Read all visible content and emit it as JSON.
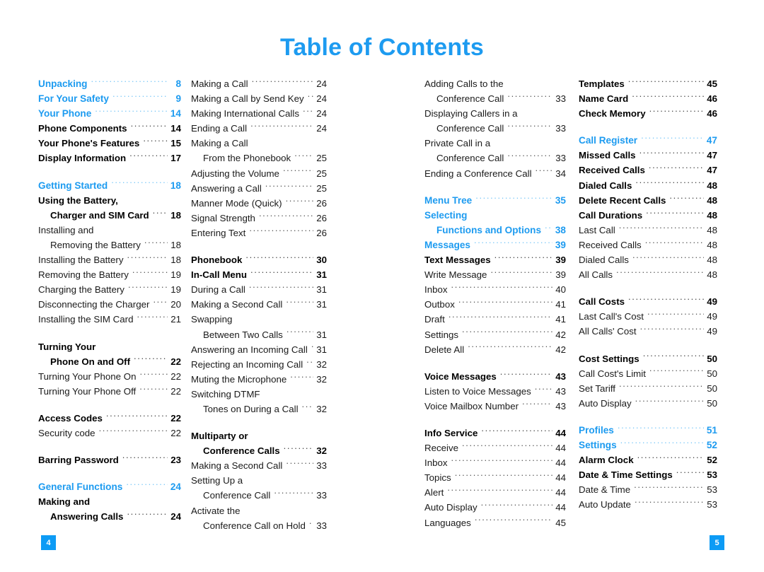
{
  "page": {
    "title": "Table of Contents",
    "accent_color": "#1d9bf0",
    "badge_color": "#0d9bf5",
    "left_page_number": "4",
    "right_page_number": "5"
  },
  "columns": [
    {
      "id": "column-1",
      "entries": [
        {
          "label": "Unpacking",
          "page": "8",
          "level": "section"
        },
        {
          "label": "For Your Safety",
          "page": "9",
          "level": "section"
        },
        {
          "label": "Your Phone",
          "page": "14",
          "level": "section"
        },
        {
          "label": "Phone Components",
          "page": "14",
          "level": "sub"
        },
        {
          "label": "Your Phone's Features",
          "page": "15",
          "level": "sub"
        },
        {
          "label": "Display Information",
          "page": "17",
          "level": "sub"
        },
        {
          "type": "gap"
        },
        {
          "label": "Getting Started",
          "page": "18",
          "level": "section"
        },
        {
          "label": "Using the Battery,",
          "page": "",
          "level": "sub",
          "leader": false
        },
        {
          "label": "Charger and SIM Card",
          "page": "18",
          "level": "sub",
          "indent": true
        },
        {
          "label": "Installing and",
          "page": "",
          "level": "item",
          "leader": false
        },
        {
          "label": "Removing the Battery",
          "page": "18",
          "level": "item",
          "indent": true
        },
        {
          "label": "Installing the Battery",
          "page": "18",
          "level": "item"
        },
        {
          "label": "Removing the Battery",
          "page": "19",
          "level": "item"
        },
        {
          "label": "Charging the Battery",
          "page": "19",
          "level": "item"
        },
        {
          "label": "Disconnecting the Charger",
          "page": "20",
          "level": "item"
        },
        {
          "label": "Installing the SIM Card",
          "page": "21",
          "level": "item"
        },
        {
          "type": "gap"
        },
        {
          "label": "Turning Your",
          "page": "",
          "level": "sub",
          "leader": false
        },
        {
          "label": "Phone On and Off",
          "page": "22",
          "level": "sub",
          "indent": true
        },
        {
          "label": "Turning Your Phone On",
          "page": "22",
          "level": "item"
        },
        {
          "label": "Turning Your Phone Off",
          "page": "22",
          "level": "item"
        },
        {
          "type": "gap"
        },
        {
          "label": "Access Codes",
          "page": "22",
          "level": "sub"
        },
        {
          "label": "Security code",
          "page": "22",
          "level": "item"
        },
        {
          "type": "gap"
        },
        {
          "label": "Barring Password",
          "page": "23",
          "level": "sub"
        },
        {
          "type": "gap"
        },
        {
          "label": "General Functions",
          "page": "24",
          "level": "section"
        },
        {
          "label": "Making and",
          "page": "",
          "level": "sub",
          "leader": false
        },
        {
          "label": "Answering Calls",
          "page": "24",
          "level": "sub",
          "indent": true
        }
      ]
    },
    {
      "id": "column-2",
      "entries": [
        {
          "label": "Making a Call",
          "page": "24",
          "level": "item"
        },
        {
          "label": "Making a Call by Send Key",
          "page": "24",
          "level": "item"
        },
        {
          "label": "Making International Calls",
          "page": "24",
          "level": "item"
        },
        {
          "label": "Ending a Call",
          "page": "24",
          "level": "item"
        },
        {
          "label": "Making a Call",
          "page": "",
          "level": "item",
          "leader": false
        },
        {
          "label": "From the Phonebook",
          "page": "25",
          "level": "item",
          "indent": true
        },
        {
          "label": "Adjusting the Volume",
          "page": "25",
          "level": "item"
        },
        {
          "label": "Answering a Call",
          "page": "25",
          "level": "item"
        },
        {
          "label": "Manner Mode (Quick)",
          "page": "26",
          "level": "item"
        },
        {
          "label": "Signal Strength",
          "page": "26",
          "level": "item"
        },
        {
          "label": "Entering Text",
          "page": "26",
          "level": "item"
        },
        {
          "type": "gap"
        },
        {
          "label": "Phonebook",
          "page": "30",
          "level": "sub"
        },
        {
          "label": "In-Call Menu",
          "page": "31",
          "level": "sub"
        },
        {
          "label": "During a Call",
          "page": "31",
          "level": "item"
        },
        {
          "label": "Making a Second Call",
          "page": "31",
          "level": "item"
        },
        {
          "label": "Swapping",
          "page": "",
          "level": "item",
          "leader": false
        },
        {
          "label": "Between Two Calls",
          "page": "31",
          "level": "item",
          "indent": true
        },
        {
          "label": "Answering an Incoming Call",
          "page": "31",
          "level": "item"
        },
        {
          "label": "Rejecting an Incoming Call",
          "page": "32",
          "level": "item"
        },
        {
          "label": "Muting the Microphone",
          "page": "32",
          "level": "item"
        },
        {
          "label": "Switching DTMF",
          "page": "",
          "level": "item",
          "leader": false
        },
        {
          "label": "Tones on During a Call",
          "page": "32",
          "level": "item",
          "indent": true
        },
        {
          "type": "gap"
        },
        {
          "label": "Multiparty or",
          "page": "",
          "level": "sub",
          "leader": false
        },
        {
          "label": "Conference Calls",
          "page": "32",
          "level": "sub",
          "indent": true
        },
        {
          "label": "Making a Second Call",
          "page": "33",
          "level": "item"
        },
        {
          "label": "Setting Up a",
          "page": "",
          "level": "item",
          "leader": false
        },
        {
          "label": "Conference Call",
          "page": "33",
          "level": "item",
          "indent": true
        },
        {
          "label": "Activate the",
          "page": "",
          "level": "item",
          "leader": false
        },
        {
          "label": "Conference Call on Hold",
          "page": "33",
          "level": "item",
          "indent": true
        }
      ]
    },
    {
      "id": "column-3",
      "entries": [
        {
          "label": "Adding Calls to the",
          "page": "",
          "level": "item",
          "leader": false
        },
        {
          "label": "Conference Call",
          "page": "33",
          "level": "item",
          "indent": true
        },
        {
          "label": "Displaying Callers in a",
          "page": "",
          "level": "item",
          "leader": false
        },
        {
          "label": "Conference Call",
          "page": "33",
          "level": "item",
          "indent": true
        },
        {
          "label": "Private Call in a",
          "page": "",
          "level": "item",
          "leader": false
        },
        {
          "label": "Conference Call",
          "page": "33",
          "level": "item",
          "indent": true
        },
        {
          "label": "Ending a Conference Call",
          "page": "34",
          "level": "item"
        },
        {
          "type": "gap"
        },
        {
          "label": "Menu Tree",
          "page": "35",
          "level": "section"
        },
        {
          "label": "Selecting",
          "page": "",
          "level": "section",
          "leader": false
        },
        {
          "label": "Functions and Options",
          "page": "38",
          "level": "section",
          "indent": true
        },
        {
          "label": "Messages",
          "page": "39",
          "level": "section"
        },
        {
          "label": "Text Messages",
          "page": "39",
          "level": "sub"
        },
        {
          "label": "Write Message",
          "page": "39",
          "level": "item"
        },
        {
          "label": "Inbox",
          "page": "40",
          "level": "item"
        },
        {
          "label": "Outbox",
          "page": "41",
          "level": "item"
        },
        {
          "label": "Draft",
          "page": "41",
          "level": "item"
        },
        {
          "label": "Settings",
          "page": "42",
          "level": "item"
        },
        {
          "label": "Delete All",
          "page": "42",
          "level": "item"
        },
        {
          "type": "gap"
        },
        {
          "label": "Voice Messages",
          "page": "43",
          "level": "sub"
        },
        {
          "label": "Listen to Voice Messages",
          "page": "43",
          "level": "item"
        },
        {
          "label": "Voice Mailbox Number",
          "page": "43",
          "level": "item"
        },
        {
          "type": "gap"
        },
        {
          "label": "Info Service",
          "page": "44",
          "level": "sub"
        },
        {
          "label": "Receive",
          "page": "44",
          "level": "item"
        },
        {
          "label": "Inbox",
          "page": "44",
          "level": "item"
        },
        {
          "label": "Topics",
          "page": "44",
          "level": "item"
        },
        {
          "label": "Alert",
          "page": "44",
          "level": "item"
        },
        {
          "label": "Auto Display",
          "page": "44",
          "level": "item"
        },
        {
          "label": "Languages",
          "page": "45",
          "level": "item"
        }
      ]
    },
    {
      "id": "column-4",
      "entries": [
        {
          "label": "Templates",
          "page": "45",
          "level": "sub"
        },
        {
          "label": "Name Card",
          "page": "46",
          "level": "sub"
        },
        {
          "label": "Check Memory",
          "page": "46",
          "level": "sub"
        },
        {
          "type": "gap"
        },
        {
          "label": "Call Register",
          "page": "47",
          "level": "section"
        },
        {
          "label": "Missed Calls",
          "page": "47",
          "level": "sub"
        },
        {
          "label": "Received Calls",
          "page": "47",
          "level": "sub"
        },
        {
          "label": "Dialed Calls",
          "page": "48",
          "level": "sub"
        },
        {
          "label": "Delete Recent Calls",
          "page": "48",
          "level": "sub"
        },
        {
          "label": "Call Durations",
          "page": "48",
          "level": "sub"
        },
        {
          "label": "Last Call",
          "page": "48",
          "level": "item"
        },
        {
          "label": "Received Calls",
          "page": "48",
          "level": "item"
        },
        {
          "label": "Dialed Calls",
          "page": "48",
          "level": "item"
        },
        {
          "label": "All Calls",
          "page": "48",
          "level": "item"
        },
        {
          "type": "gap"
        },
        {
          "label": "Call Costs",
          "page": "49",
          "level": "sub"
        },
        {
          "label": "Last Call's Cost",
          "page": "49",
          "level": "item"
        },
        {
          "label": "All Calls' Cost",
          "page": "49",
          "level": "item"
        },
        {
          "type": "gap"
        },
        {
          "label": "Cost Settings",
          "page": "50",
          "level": "sub"
        },
        {
          "label": "Call Cost's Limit",
          "page": "50",
          "level": "item"
        },
        {
          "label": "Set Tariff",
          "page": "50",
          "level": "item"
        },
        {
          "label": "Auto Display",
          "page": "50",
          "level": "item"
        },
        {
          "type": "gap"
        },
        {
          "label": "Profiles",
          "page": "51",
          "level": "section"
        },
        {
          "label": "Settings",
          "page": "52",
          "level": "section"
        },
        {
          "label": "Alarm Clock",
          "page": "52",
          "level": "sub"
        },
        {
          "label": "Date & Time Settings",
          "page": "53",
          "level": "sub"
        },
        {
          "label": "Date & Time",
          "page": "53",
          "level": "item"
        },
        {
          "label": "Auto Update",
          "page": "53",
          "level": "item"
        }
      ]
    }
  ]
}
